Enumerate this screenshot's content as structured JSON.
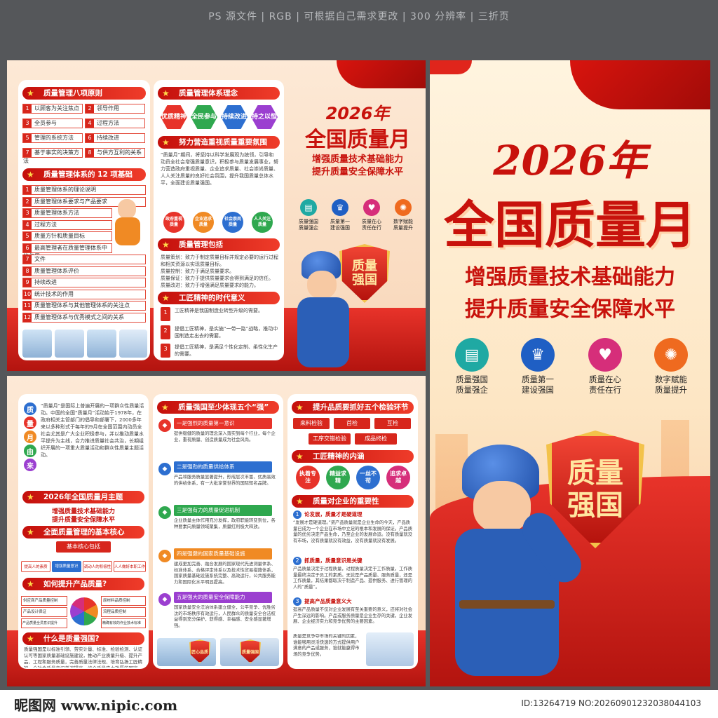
{
  "header": {
    "banner": "PS 源文件 | RGB | 可根据自己需求更改 | 300 分辨率 | 三折页"
  },
  "footer": {
    "logo": "昵图网 www.nipic.com",
    "id": "ID:13264719 NO:20260901232038044103"
  },
  "main": {
    "year": "2026年",
    "title": "全国质量月",
    "slogan1": "增强质量技术基础能力",
    "slogan2": "提升质量安全保障水平",
    "icons": [
      {
        "icon": "document-icon",
        "label1": "质量强国",
        "label2": "质量强企",
        "color": "#1fa9a3"
      },
      {
        "icon": "trophy-icon",
        "label1": "质量第一",
        "label2": "建设强国",
        "color": "#1f5fc4"
      },
      {
        "icon": "heart-icon",
        "label1": "质量在心",
        "label2": "责任在行",
        "color": "#d62e7a"
      },
      {
        "icon": "atom-icon",
        "label1": "数字赋能",
        "label2": "质量提升",
        "color": "#ef6a1f"
      }
    ],
    "shield_text1": "质量",
    "shield_text2": "强国"
  },
  "principles": {
    "title": "质量管理八项原则",
    "items": [
      "以顾客为关注焦点",
      "领导作用",
      "全员参与",
      "过程方法",
      "管理的系统方法",
      "持续改进",
      "基于事实的决策方法",
      "与供方互利的关系"
    ],
    "nums": [
      "1",
      "2",
      "3",
      "4",
      "5",
      "6",
      "7",
      "8"
    ]
  },
  "basis": {
    "title": "质量管理体系的 12 项基础",
    "items": [
      "质量管理体系的理论说明",
      "质量管理体系要求与产品要求",
      "质量管理体系方法",
      "过程方法",
      "质量方针和质量目标",
      "最高管理者在质量管理体系中的作用",
      "文件",
      "质量管理体系评价",
      "持续改进",
      "统计技术的作用",
      "质量管理体系与其他管理体系的关注点",
      "质量管理体系与优秀模式之间的关系"
    ],
    "nums": [
      "1",
      "2",
      "3",
      "4",
      "5",
      "6",
      "7",
      "8",
      "9",
      "10",
      "11",
      "12"
    ]
  },
  "concept": {
    "title": "质量管理体系理念",
    "hexes": [
      "优质精神",
      "全民参与",
      "持续改进",
      "持之以恒"
    ],
    "subtitle": "努力营造重视质量重要氛围",
    "para": "“质量月”期间，将坚持以科学发展观为统领，引导和动员全社会增强质量意识，积极参与质量发展事业，努力营造政府重视质量、企业追求质量、社会崇尚质量、人人关注质量的良好社会氛围，提升我国质量总体水平，全面建设质量强国。",
    "circles": [
      "政府重视质量",
      "企业追求质量",
      "社会崇尚质量",
      "人人关注质量"
    ]
  },
  "includes": {
    "title": "质量管理包括",
    "lines": [
      "质量策划：致力于制定质量目标并规定必要的运行过程和相关资源以实现质量目标。",
      "质量控制：致力于满足质量要求。",
      "质量保证：致力于提供质量要求会得到满足的信任。",
      "质量改进：致力于增强满足质量要求的能力。"
    ]
  },
  "craftsman": {
    "title": "工匠精神的时代意义",
    "items": [
      "工匠精神是我国制造业转型升级的需要。",
      "提倡工匠精神，是实施“一带一路”战略，推动中国制造走出去的需要。",
      "提倡工匠精神，是满足个性化定制、柔性化生产的需要。"
    ]
  },
  "back": {
    "vertical": [
      "质",
      "量",
      "月",
      "由",
      "来"
    ],
    "intro": "“质量月”是国际上普遍开展的一项群众性质量活动。中国的全国“质量月”活动始于1978年，在政府相关主管部门的倡导和部署下，2000多年来以多种形式于每年的9月在全国范围内动员全社会尤其是广大企业积极参与，并以推动质量水平提升为主线，合力推进质量社会共治，长期组织开展的一项重大质量活动和群众性质量主题活动。",
    "theme_title": "2026年全国质量月主题",
    "theme1": "增强质量技术基础能力",
    "theme2": "提升质量安全保障水平",
    "core_title": "全面质量管理的基本核心",
    "core_head": "基本核心包括",
    "core_items": [
      "提高人的素质",
      "增强质量意识",
      "调动人的积极性",
      "人人做好本职工作"
    ],
    "improve_title": "如何提升产品质量?",
    "improve_items": [
      "供应商产品质量控制",
      "原材料品质控制",
      "产品设计保证",
      "流程品质控制",
      "产品质量全员意识提升",
      "精确有效的作业技术标准"
    ],
    "what_title": "什么是质量强国?",
    "what_para": "质量强国是以标准引领、劳实计量、标准、检验检测、认证认可等国家质量基础设施建设，推动产业质量升级、提升产品、工程和服务质量，完善质量法律法规、培育弘扬工匠精神，全社会质量意识普遍提高，综合质量实力雄厚的国家。"
  },
  "five": {
    "title": "质量强国至少体现五个“强”",
    "items": [
      {
        "head": "一是强烈的质量第一意识",
        "text": "提供稳健的质量的理念深入落实到每个行业，每个企业，重视质量、创造质量成为社会风尚。"
      },
      {
        "head": "二是强劲的质量供给体系",
        "text": "产品和服务质量显著提升，形成层次丰富、优质高效的供给体系，有一大批享誉世界的国际知名品牌。"
      },
      {
        "head": "三是强有力的质量促进机制",
        "text": "企业质量主体作用充分发挥，政府职能转变到位，各种要素向质量领域聚集，质量红利极大释放。"
      },
      {
        "head": "四是强健的国家质量基础设施",
        "text": "建成更加完善、融合发展的国家现代先进测量体系、标准体系、合格评定体系以及技术性贸易措施体系，国家质量基础设施系统完整、高效运行，公共服务能力和国际化水平明显提高。"
      },
      {
        "head": "五是强大的质量安全保障能力",
        "text": "国家质量安全法治体系建立健全，公平竞争、优胜劣汰的市场秩序有效运行，人民群众的质量安全合法权益得到充分保护，获得感、幸福感、安全感显著增强。"
      }
    ],
    "photo_labels": [
      "匠心品质",
      "质量强国"
    ]
  },
  "inspect": {
    "title": "提升品质要抓好五个检验环节",
    "tags": [
      "来料检验",
      "首检",
      "互检",
      "工序交错检验",
      "成品终检"
    ],
    "spirit_title": "工匠精神的内涵",
    "spirit": [
      "执着专注",
      "精益求精",
      "一丝不苟",
      "追求卓越"
    ],
    "importance_title": "质量对企业的重要性",
    "points": [
      {
        "head": "论发展，质量才是硬道理",
        "text": "“发展才是硬道理。”资产品质量就是企业生命的今天，产品质量已成为一个企业在市场中立足的根本和发展的保证。产品质量的优劣决定产品生命，乃至企业的发展命运。没有质量就没有市场，没有质量就没有效益，没有质量就没有发展。"
      },
      {
        "head": "抓质量，质量意识是关键",
        "text": "产品质量决定于过程质量，过程质量决定于工作质量，工作质量最终决定于员工的素质。无论是产品质量、服务质量，还是工作质量，其结果都取决于制造产品、提供服务、进行管理的人的“质量”。"
      },
      {
        "head": "提高产品质量意义大",
        "text": "提高产品质量不仅对企业发展有至关重要的意义，还将对社会产生深远的影响。产品或服务质量是企业生存的关键，企业发展、企业经济实力和竞争优势的主要因素。"
      }
    ],
    "tail": "质量是竞争夺市场的关键的因素，谁能够用灵活快速的方式提供用户满意的产品或服务，谁就能赢得市场的竞争优势。"
  }
}
